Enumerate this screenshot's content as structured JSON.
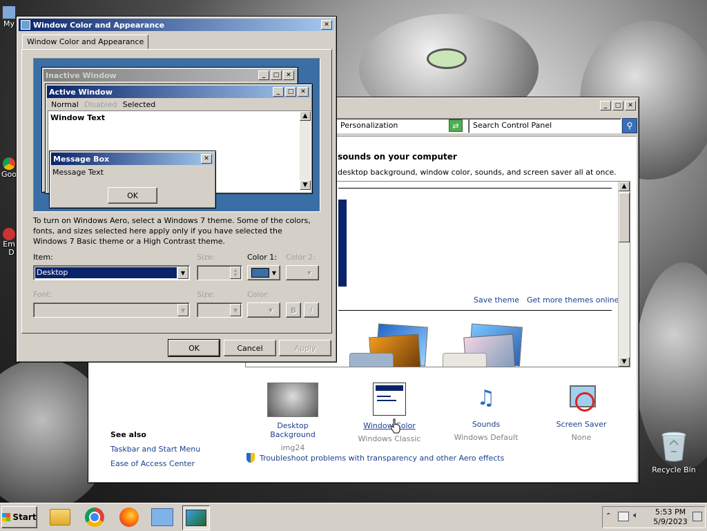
{
  "desktop": {
    "icons": [
      {
        "label": "My",
        "icon": "computer-icon"
      },
      {
        "label": "Goo",
        "icon": "chrome-icon"
      },
      {
        "label": "Em\nD",
        "icon": "app-icon"
      }
    ],
    "recycle_bin": {
      "label": "Recycle Bin",
      "icon": "recycle-bin-icon"
    }
  },
  "control_panel": {
    "address": "Personalization",
    "search_placeholder": "Search Control Panel",
    "heading": "sounds on your computer",
    "description": "desktop background, window color, sounds, and screen saver all at once.",
    "save_theme": "Save theme",
    "get_more_themes": "Get more themes online",
    "tiles": [
      {
        "label": "Desktop Background",
        "sub": "img24",
        "icon": "desktop-background-icon"
      },
      {
        "label": "Window Color",
        "sub": "Windows Classic",
        "icon": "window-color-icon"
      },
      {
        "label": "Sounds",
        "sub": "Windows Default",
        "icon": "sounds-icon"
      },
      {
        "label": "Screen Saver",
        "sub": "None",
        "icon": "screen-saver-icon"
      }
    ],
    "see_also": {
      "title": "See also",
      "links": [
        "Taskbar and Start Menu",
        "Ease of Access Center"
      ]
    },
    "troubleshoot": "Troubleshoot problems with transparency and other Aero effects"
  },
  "dialog": {
    "title": "Window Color and Appearance",
    "tab": "Window Color and Appearance",
    "preview": {
      "inactive_title": "Inactive Window",
      "active_title": "Active Window",
      "menu": [
        "Normal",
        "Disabled",
        "Selected"
      ],
      "window_text": "Window Text",
      "msgbox_title": "Message Box",
      "msgbox_text": "Message Text",
      "msgbox_ok": "OK"
    },
    "info": "To turn on Windows Aero, select a Windows 7 theme.  Some of the colors, fonts, and sizes selected here apply only if you have selected the Windows 7 Basic theme or a High Contrast theme.",
    "item_label": "Item:",
    "item_value": "Desktop",
    "size_label": "Size:",
    "color1_label": "Color 1:",
    "color2_label": "Color 2:",
    "font_label": "Font:",
    "font_size_label": "Size:",
    "font_color_label": "Color:",
    "bold": "B",
    "italic": "I",
    "ok": "OK",
    "cancel": "Cancel",
    "apply": "Apply"
  },
  "taskbar": {
    "start": "Start",
    "apps": [
      "file-explorer-icon",
      "chrome-icon",
      "firefox-icon",
      "control-panel-icon",
      "personalization-icon"
    ],
    "time": "5:53 PM",
    "date": "5/9/2023"
  },
  "colors": {
    "title_active": "#0a246a",
    "title_gradient_end": "#a6caf0",
    "desktop_preview": "#3a6ea5",
    "selection": "#0a246a",
    "face": "#d4d0c8",
    "link": "#1a3f8f"
  }
}
